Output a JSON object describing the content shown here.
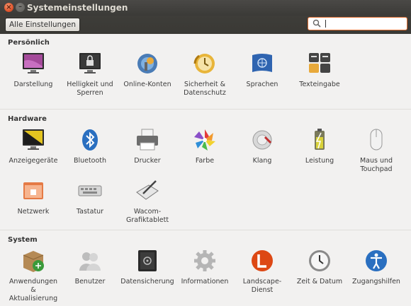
{
  "window": {
    "title": "Systemeinstellungen"
  },
  "toolbar": {
    "all_settings": "Alle Einstellungen",
    "search_placeholder": ""
  },
  "sections": {
    "personal": {
      "title": "Persönlich",
      "items": [
        "Darstellung",
        "Helligkeit und Sperren",
        "Online-Konten",
        "Sicherheit & Datenschutz",
        "Sprachen",
        "Texteingabe"
      ]
    },
    "hardware": {
      "title": "Hardware",
      "items": [
        "Anzeigegeräte",
        "Bluetooth",
        "Drucker",
        "Farbe",
        "Klang",
        "Leistung",
        "Maus und Touchpad",
        "Netzwerk",
        "Tastatur",
        "Wacom-Grafiktablett"
      ]
    },
    "system": {
      "title": "System",
      "items": [
        "Anwendungen & Aktualisierung",
        "Benutzer",
        "Datensicherung",
        "Informationen",
        "Landscape-Dienst",
        "Zeit & Datum",
        "Zugangshilfen"
      ]
    }
  }
}
